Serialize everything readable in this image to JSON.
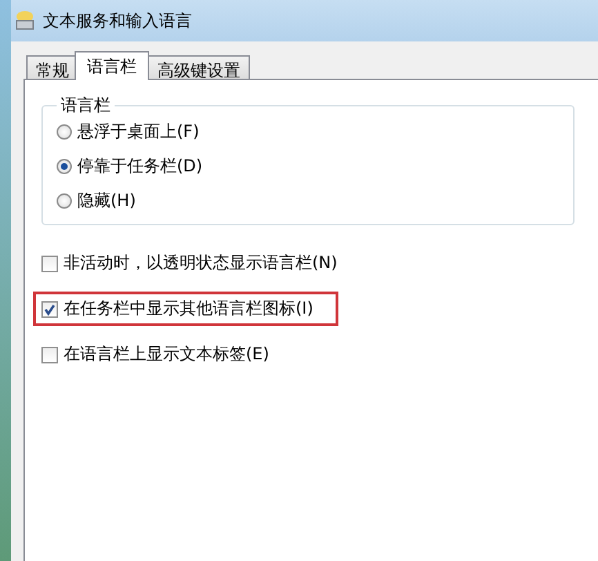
{
  "window": {
    "title": "文本服务和输入语言"
  },
  "tabs": [
    {
      "label": "常规",
      "selected": false
    },
    {
      "label": "语言栏",
      "selected": true
    },
    {
      "label": "高级键设置",
      "selected": false
    }
  ],
  "language_bar_group": {
    "title": "语言栏",
    "options": [
      {
        "label": "悬浮于桌面上(F)",
        "selected": false
      },
      {
        "label": "停靠于任务栏(D)",
        "selected": true
      },
      {
        "label": "隐藏(H)",
        "selected": false
      }
    ]
  },
  "checkboxes": [
    {
      "label": "非活动时，以透明状态显示语言栏(N)",
      "checked": false,
      "highlighted": false
    },
    {
      "label": "在任务栏中显示其他语言栏图标(I)",
      "checked": true,
      "highlighted": true
    },
    {
      "label": "在语言栏上显示文本标签(E)",
      "checked": false,
      "highlighted": false
    }
  ]
}
